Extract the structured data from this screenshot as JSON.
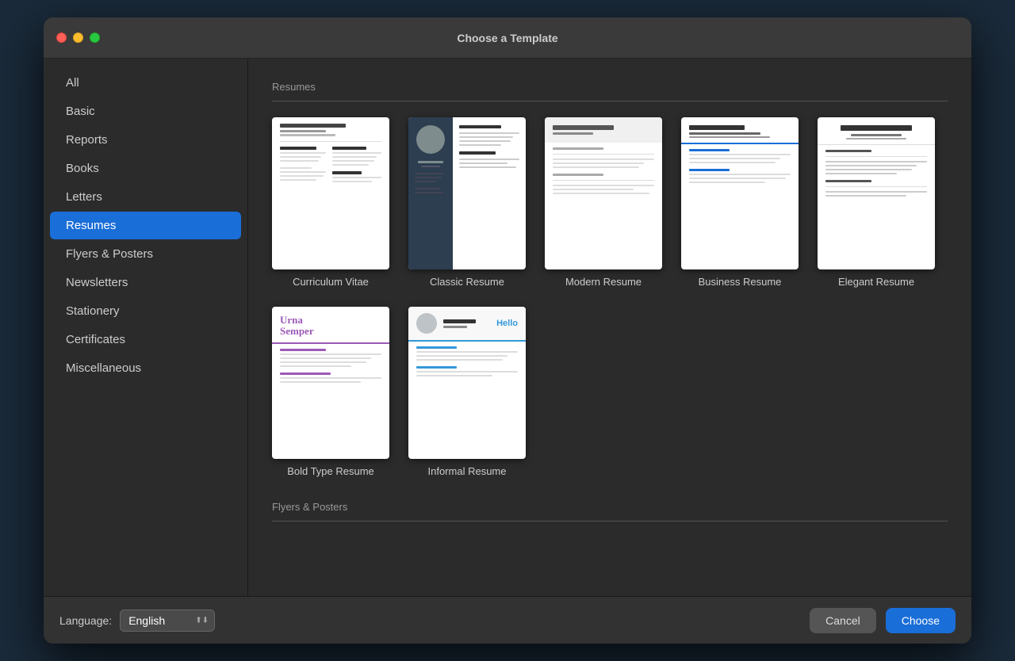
{
  "window": {
    "title": "Choose a Template"
  },
  "sidebar": {
    "items": [
      {
        "id": "all",
        "label": "All",
        "active": false
      },
      {
        "id": "basic",
        "label": "Basic",
        "active": false
      },
      {
        "id": "reports",
        "label": "Reports",
        "active": false
      },
      {
        "id": "books",
        "label": "Books",
        "active": false
      },
      {
        "id": "letters",
        "label": "Letters",
        "active": false
      },
      {
        "id": "resumes",
        "label": "Resumes",
        "active": true
      },
      {
        "id": "flyers-posters",
        "label": "Flyers & Posters",
        "active": false
      },
      {
        "id": "newsletters",
        "label": "Newsletters",
        "active": false
      },
      {
        "id": "stationery",
        "label": "Stationery",
        "active": false
      },
      {
        "id": "certificates",
        "label": "Certificates",
        "active": false
      },
      {
        "id": "miscellaneous",
        "label": "Miscellaneous",
        "active": false
      }
    ]
  },
  "main": {
    "sections": [
      {
        "id": "resumes",
        "title": "Resumes",
        "templates": [
          {
            "id": "curriculum-vitae",
            "name": "Curriculum Vitae",
            "style": "cv"
          },
          {
            "id": "classic-resume",
            "name": "Classic Resume",
            "style": "classic"
          },
          {
            "id": "modern-resume",
            "name": "Modern Resume",
            "style": "modern"
          },
          {
            "id": "business-resume",
            "name": "Business Resume",
            "style": "business"
          },
          {
            "id": "elegant-resume",
            "name": "Elegant Resume",
            "style": "elegant"
          },
          {
            "id": "bold-type-resume",
            "name": "Bold Type Resume",
            "style": "bold"
          },
          {
            "id": "informal-resume",
            "name": "Informal Resume",
            "style": "informal"
          }
        ]
      },
      {
        "id": "flyers-posters",
        "title": "Flyers & Posters",
        "templates": []
      }
    ]
  },
  "footer": {
    "language_label": "Language:",
    "language_value": "English",
    "cancel_label": "Cancel",
    "choose_label": "Choose"
  }
}
